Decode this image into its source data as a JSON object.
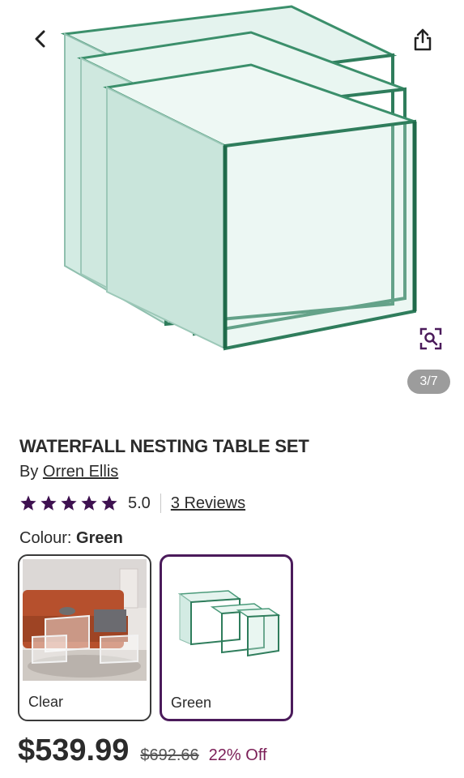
{
  "gallery": {
    "counter": "3/7",
    "icons": {
      "back": "chevron-left-icon",
      "share": "share-icon",
      "zoom": "zoom-icon"
    }
  },
  "product": {
    "title": "WATERFALL NESTING TABLE SET",
    "by_prefix": "By",
    "brand": "Orren Ellis",
    "rating": "5.0",
    "rating_fraction": 1.0,
    "reviews_label": "3 Reviews",
    "colour_label": "Colour:",
    "colour_value": "Green"
  },
  "swatches": [
    {
      "label": "Clear",
      "selected": false
    },
    {
      "label": "Green",
      "selected": true
    }
  ],
  "pricing": {
    "price": "$539.99",
    "was_price": "$692.66",
    "discount": "22% Off"
  },
  "colors": {
    "star": "#3e1150",
    "selected_border": "#4b1b5b",
    "discount": "#7b1e57",
    "glass_edge": "#2f7d5c",
    "glass_fill": "#d9efe8"
  }
}
